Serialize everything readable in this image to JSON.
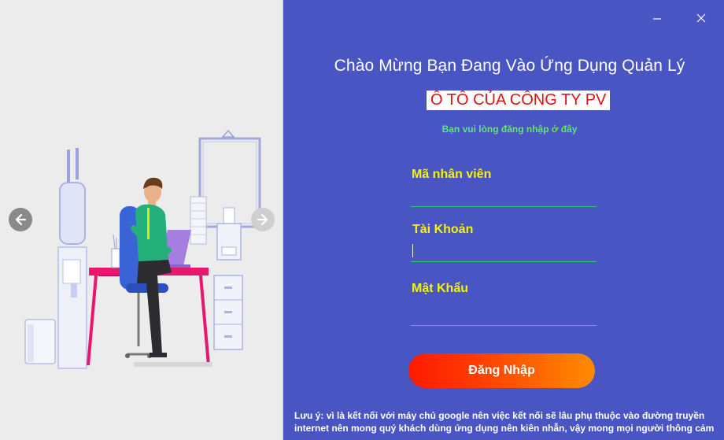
{
  "window": {
    "minimize_icon": "minimize-icon",
    "close_icon": "close-icon"
  },
  "slideshow": {
    "prev_icon": "arrow-left-icon",
    "next_icon": "arrow-right-icon"
  },
  "header": {
    "welcome": "Chào Mừng Bạn Đang Vào Ứng Dụng Quản Lý",
    "company": "Ô TÔ CỦA CÔNG TY PV",
    "hint": "Bạn vui lòng đăng nhập ở đây"
  },
  "form": {
    "employee_id": {
      "label": "Mã nhân viên",
      "value": ""
    },
    "account": {
      "label": "Tài Khoản",
      "value": ""
    },
    "password": {
      "label": "Mật Khẩu",
      "value": ""
    },
    "login_label": "Đăng Nhập"
  },
  "footer": {
    "note_line1": "Lưu ý: vì là kết nối với máy chủ google nên việc kết nối sẽ lâu phụ thuộc vào đường truyền",
    "note_line2": "internet nên mong quý khách dùng ứng dụng nên kiên nhẫn, vậy mong mọi người thông cảm"
  },
  "colors": {
    "panel_bg": "#4a55c4",
    "label": "#f5f500",
    "hint": "#66e07a",
    "underline": "#2ecc71",
    "company_text": "#e01212",
    "button_start": "#ff1a00",
    "button_end": "#ff8c00"
  }
}
